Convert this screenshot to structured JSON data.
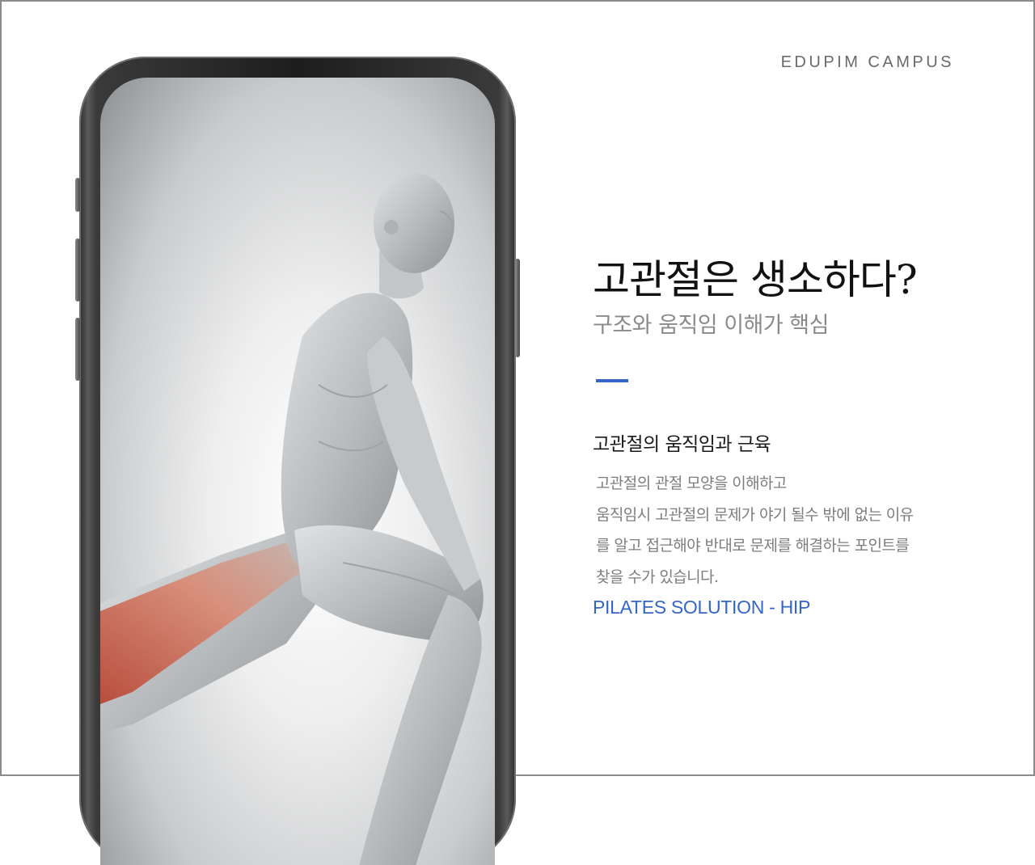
{
  "brand": {
    "name": "EDUPIM CAMPUS"
  },
  "hero": {
    "title": "고관절은 생소하다?",
    "subtitle": "구조와 움직임 이해가 핵심"
  },
  "section": {
    "title": "고관절의 움직임과 근육",
    "body_lines": [
      "고관절의 관절 모양을 이해하고",
      "움직임시 고관절의 문제가 야기 될수 밖에 없는 이유",
      "를 알고 접근해야 반대로 문제를 해결하는 포인트를",
      "찾을 수가 있습니다."
    ],
    "tagline": "PILATES SOLUTION - HIP"
  },
  "colors": {
    "accent": "#3466c8",
    "title": "#111111",
    "muted": "#8a8a8a",
    "muscle_highlight": "#c9533e"
  },
  "illustration": {
    "subject": "anatomy-figure-lunge-stretch"
  }
}
